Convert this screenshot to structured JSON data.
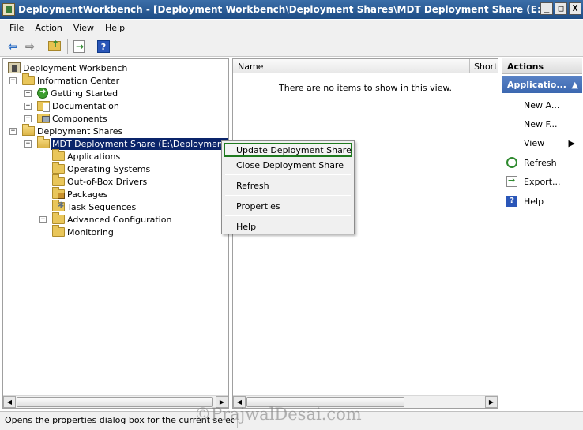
{
  "window": {
    "title": "DeploymentWorkbench - [Deployment Workbench\\Deployment Shares\\MDT Deployment Share (E:\\DeploymentSh...",
    "minimize": "_",
    "maximize": "□",
    "close": "X"
  },
  "menu": [
    "File",
    "Action",
    "View",
    "Help"
  ],
  "toolbar": {
    "back": "⇦",
    "forward": "⇨",
    "help": "?"
  },
  "tree": {
    "root": "Deployment Workbench",
    "info_center": "Information Center",
    "getting_started": "Getting Started",
    "documentation": "Documentation",
    "components": "Components",
    "deployment_shares": "Deployment Shares",
    "mdt_share": "MDT Deployment Share (E:\\DeploymentShare",
    "applications": "Applications",
    "operating_systems": "Operating Systems",
    "drivers": "Out-of-Box Drivers",
    "packages": "Packages",
    "task_sequences": "Task Sequences",
    "advanced_config": "Advanced Configuration",
    "monitoring": "Monitoring",
    "plus": "+",
    "minus": "−"
  },
  "list": {
    "col_name": "Name",
    "col_short": "Shortl",
    "empty_message": "There are no items to show in this view."
  },
  "actions": {
    "header": "Actions",
    "subheader": "Applicatio...",
    "subheader_arrow": "▲",
    "items": [
      "New A...",
      "New F...",
      "View",
      "Refresh",
      "Export...",
      "Help"
    ],
    "view_arrow": "▶"
  },
  "context_menu": [
    "Update Deployment Share",
    "Close Deployment Share",
    "Refresh",
    "Properties",
    "Help"
  ],
  "scroll": {
    "left": "◀",
    "right": "▶"
  },
  "status": {
    "text": "Opens the properties dialog box for the current selection."
  },
  "watermark": "©PrajwalDesai.com"
}
